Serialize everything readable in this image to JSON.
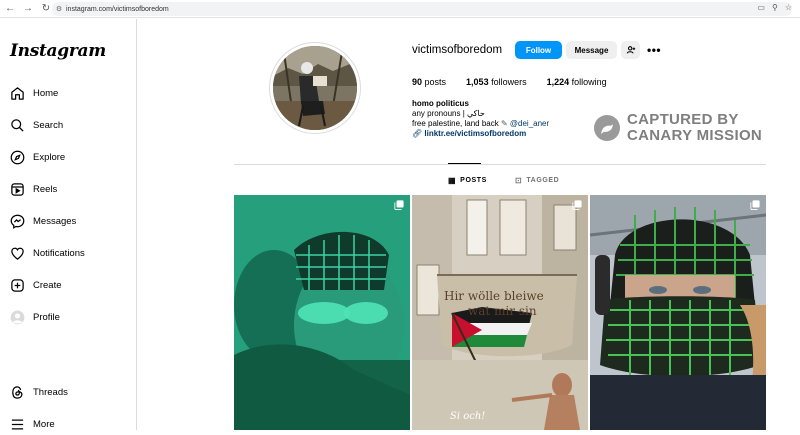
{
  "browser": {
    "url": "instagram.com/victimsofboredom"
  },
  "sidebar": {
    "logo": "Instagram",
    "items": [
      {
        "label": "Home",
        "icon": "home-icon"
      },
      {
        "label": "Search",
        "icon": "search-icon"
      },
      {
        "label": "Explore",
        "icon": "compass-icon"
      },
      {
        "label": "Reels",
        "icon": "reels-icon"
      },
      {
        "label": "Messages",
        "icon": "messenger-icon"
      },
      {
        "label": "Notifications",
        "icon": "heart-icon"
      },
      {
        "label": "Create",
        "icon": "plus-square-icon"
      },
      {
        "label": "Profile",
        "icon": "profile-avatar-icon"
      },
      {
        "label": "Threads",
        "icon": "threads-icon"
      },
      {
        "label": "More",
        "icon": "hamburger-icon"
      }
    ]
  },
  "profile": {
    "username": "victimsofboredom",
    "follow_label": "Follow",
    "message_label": "Message",
    "stats": {
      "posts_count": "90",
      "posts_label": "posts",
      "followers_count": "1,053",
      "followers_label": "followers",
      "following_count": "1,224",
      "following_label": "following"
    },
    "bio": {
      "name": "homo politicus",
      "line1": "any pronouns | حاكي",
      "line2": "free palestine, land back",
      "mention": "@dei_aner",
      "link": "linktr.ee/victimsofboredom"
    }
  },
  "watermark": {
    "line1": "CAPTURED BY",
    "line2": "CANARY MISSION"
  },
  "tabs": {
    "posts": "POSTS",
    "tagged": "TAGGED"
  },
  "posts": {
    "post2_sign_line1": "Hir wölle bleiwe",
    "post2_sign_line2": "wat mir sin",
    "post2_caption": "Si och!"
  },
  "colors": {
    "follow_blue": "#0095f6",
    "link_blue": "#00376b",
    "secondary_text": "#737373"
  }
}
